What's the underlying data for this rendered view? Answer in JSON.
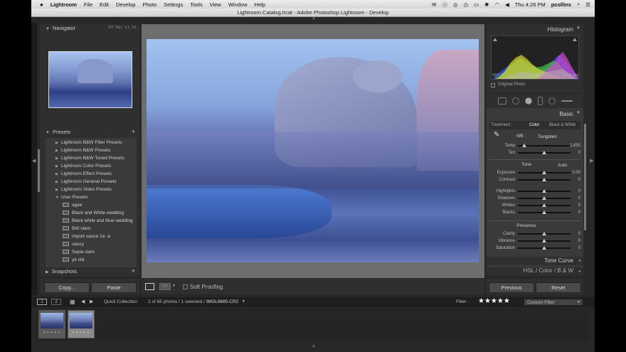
{
  "menubar": {
    "apple": "",
    "items": [
      "Lightroom",
      "File",
      "Edit",
      "Develop",
      "Photo",
      "Settings",
      "Tools",
      "View",
      "Window",
      "Help"
    ],
    "clock": "Thu 4:26 PM",
    "user": "pcollins"
  },
  "window": {
    "title": "Lightroom Catalog.lrcat - Adobe Photoshop Lightroom - Develop"
  },
  "navigator": {
    "title": "Navigator",
    "zoom_fit": "FIT",
    "zoom_fill": "FILL",
    "zoom_1": "1:1",
    "zoom_3": "3:1"
  },
  "presets": {
    "title": "Presets",
    "add": "+",
    "folders": [
      "Lightroom B&W Filter Presets",
      "Lightroom B&W Presets",
      "Lightroom B&W Toned Presets",
      "Lightroom Color Presets",
      "Lightroom Effect Presets",
      "Lightroom General Presets",
      "Lightroom Video Presets",
      "User Presets"
    ],
    "user_presets": [
      "agee",
      "Black and White wedding",
      "Black white and blue wedding",
      "BW slam",
      "import sauce 1a -a",
      "saucy",
      "Sepia slam",
      "ye old"
    ]
  },
  "snapshots": {
    "title": "Snapshots",
    "add": "+"
  },
  "left_buttons": {
    "copy": "Copy...",
    "paste": "Paste"
  },
  "toolbar": {
    "soft_proofing": "Soft Proofing"
  },
  "histogram": {
    "title": "Histogram",
    "iso": "ISO 100",
    "focal": "26 mm",
    "aperture": "f / 2.8",
    "shutter": "1/640 sec",
    "original": "Original Photo"
  },
  "basic": {
    "title": "Basic",
    "treatment_label": "Treatment :",
    "color": "Color",
    "bw": "Black & White",
    "wb_label": "WB :",
    "wb_value": "Tungsten",
    "tone_label": "Tone",
    "auto": "Auto",
    "presence_label": "Presence",
    "sliders_wb": [
      {
        "label": "Temp",
        "value": "2,850",
        "pos": 0.12
      },
      {
        "label": "Tint",
        "value": "0",
        "pos": 0.5
      }
    ],
    "sliders_tone": [
      {
        "label": "Exposure",
        "value": "0.00",
        "pos": 0.5
      },
      {
        "label": "Contrast",
        "value": "0",
        "pos": 0.5
      }
    ],
    "sliders_tone2": [
      {
        "label": "Highlights",
        "value": "0",
        "pos": 0.5
      },
      {
        "label": "Shadows",
        "value": "0",
        "pos": 0.5
      },
      {
        "label": "Whites",
        "value": "0",
        "pos": 0.5
      },
      {
        "label": "Blacks",
        "value": "0",
        "pos": 0.5
      }
    ],
    "sliders_presence": [
      {
        "label": "Clarity",
        "value": "0",
        "pos": 0.5
      },
      {
        "label": "Vibrance",
        "value": "0",
        "pos": 0.5
      },
      {
        "label": "Saturation",
        "value": "0",
        "pos": 0.5
      }
    ]
  },
  "tone_curve": {
    "title": "Tone Curve"
  },
  "hsl": {
    "hsl": "HSL",
    "color": "Color",
    "bw": "B & W"
  },
  "right_buttons": {
    "previous": "Previous",
    "reset": "Reset"
  },
  "filmstrip": {
    "page1": "1",
    "page2": "2",
    "source": "Quick Collection",
    "count": "2 of 65 photos / 1 selected /",
    "filename": "IMGL9685.CR2",
    "filter_label": "Filter :",
    "stars": "★★★★★",
    "filter_value": "Custom Filter",
    "thumb_dots": "• • • • •"
  },
  "colors": {
    "panel": "#3a3a3a",
    "bg": "#282828",
    "accent": "#ffffff"
  }
}
